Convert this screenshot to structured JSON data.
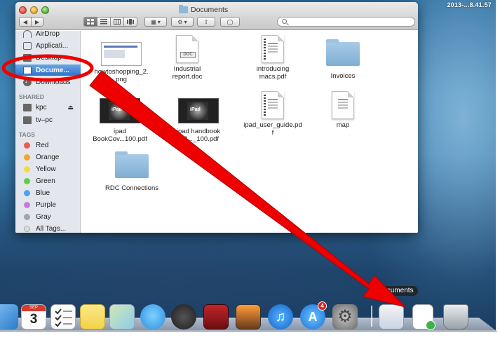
{
  "menubar": {
    "clock": "2013-...8.41.57"
  },
  "window": {
    "title": "Documents"
  },
  "toolbar": {
    "back_label": "◀",
    "forward_label": "▶",
    "arrange_label": "▦ ▾",
    "action_label": "⚙ ▾",
    "share_label": "⇪",
    "tags_label": "◯",
    "search_placeholder": ""
  },
  "sidebar": {
    "favorites": [
      {
        "label": "AirDrop",
        "icon": "airdrop-icon"
      },
      {
        "label": "Applicati...",
        "icon": "applications-icon"
      },
      {
        "label": "Desktop",
        "icon": "desktop-icon"
      },
      {
        "label": "Docume...",
        "icon": "documents-icon",
        "selected": true
      },
      {
        "label": "Downloads",
        "icon": "downloads-icon"
      }
    ],
    "shared_heading": "SHARED",
    "shared": [
      {
        "label": "kpc",
        "icon": "computer-icon",
        "eject": "⏏"
      },
      {
        "label": "tv–pc",
        "icon": "computer-icon"
      }
    ],
    "tags_heading": "TAGS",
    "tags": [
      {
        "label": "Red",
        "color": "#f05a52"
      },
      {
        "label": "Orange",
        "color": "#f6a42c"
      },
      {
        "label": "Yellow",
        "color": "#f5dc38"
      },
      {
        "label": "Green",
        "color": "#5fcf4a"
      },
      {
        "label": "Blue",
        "color": "#4aa3f5"
      },
      {
        "label": "Purple",
        "color": "#c97ae0"
      },
      {
        "label": "Gray",
        "color": "#a5a5a5"
      },
      {
        "label": "All Tags...",
        "color": "#dcdcdc"
      }
    ]
  },
  "files": [
    {
      "name": "howtoshopping_2.\npng",
      "kind": "screenshot"
    },
    {
      "name": "Industrial\nreport.doc",
      "kind": "doc",
      "tag": "DOC"
    },
    {
      "name": "introducing\nmacs.pdf",
      "kind": "pdf"
    },
    {
      "name": "Invoices",
      "kind": "folder"
    },
    {
      "name": "ipad\nBookCov...100.pdf",
      "kind": "dark",
      "tag": "iPad"
    },
    {
      "name": "ipad handbook\n...8..._100.pdf",
      "kind": "dark",
      "tag": "iPad"
    },
    {
      "name": "ipad_user_guide.pd\nf",
      "kind": "pdf"
    },
    {
      "name": "map",
      "kind": "pdf"
    },
    {
      "name": "RDC Connections",
      "kind": "folder"
    }
  ],
  "dock": {
    "tooltip": "Documents",
    "calendar_day": "3",
    "calendar_month": "SEP",
    "appstore_badge": "4",
    "items": [
      "finder-icon",
      "calendar-icon",
      "reminders-icon",
      "notes-icon",
      "maps-icon",
      "messages-icon",
      "facetime-icon",
      "photo-booth-icon",
      "iphoto-icon",
      "itunes-icon",
      "app-store-icon",
      "system-preferences-icon",
      "documents-stack-icon",
      "preview-icon",
      "trash-icon"
    ]
  },
  "colors": {
    "selection": "#2f73c8",
    "arrow": "#ee0000"
  }
}
